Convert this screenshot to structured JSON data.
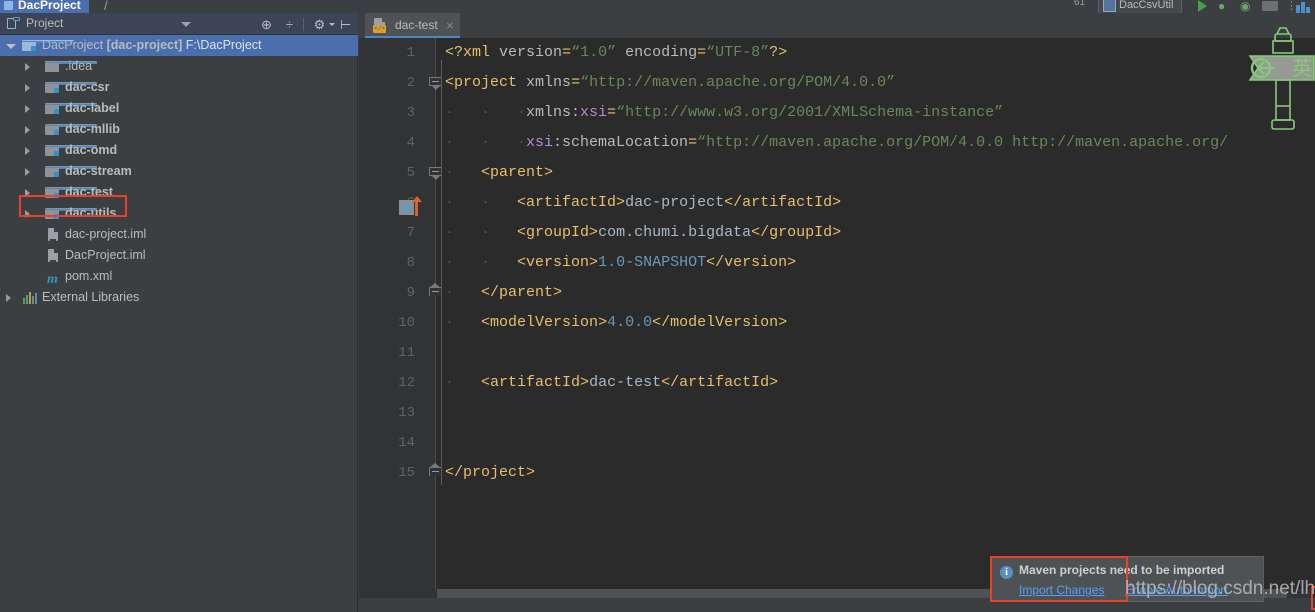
{
  "window": {
    "breadcrumb": "DacProject",
    "breadcrumb_sep": "/"
  },
  "topbar": {
    "run_config": "DacCsvUtil",
    "line_indicator": "61",
    "icons": [
      "run-icon",
      "debug-icon",
      "coverage-icon",
      "stop-icon",
      "more-icon",
      "layout-icon"
    ]
  },
  "project_panel": {
    "title": "Project",
    "toolbar": {
      "locate": "target-icon",
      "collapse_all": "collapse-all-icon",
      "settings": "gear-icon",
      "hide": "hide-icon"
    },
    "tree": [
      {
        "label": "DacProject",
        "module": "[dac-project]",
        "path": "F:\\DacProject",
        "icon": "module-folder-icon",
        "depth": 0,
        "state": "expanded",
        "selected": true
      },
      {
        "label": ".idea",
        "icon": "folder-icon",
        "depth": 1,
        "state": "collapsed",
        "selected": false
      },
      {
        "label": "dac-csr",
        "icon": "module-folder-icon",
        "depth": 1,
        "state": "collapsed",
        "selected": false
      },
      {
        "label": "dac-label",
        "icon": "module-folder-icon",
        "depth": 1,
        "state": "collapsed",
        "selected": false
      },
      {
        "label": "dac-mllib",
        "icon": "module-folder-icon",
        "depth": 1,
        "state": "collapsed",
        "selected": false
      },
      {
        "label": "dac-omd",
        "icon": "module-folder-icon",
        "depth": 1,
        "state": "collapsed",
        "selected": false
      },
      {
        "label": "dac-stream",
        "icon": "module-folder-icon",
        "depth": 1,
        "state": "collapsed",
        "selected": false
      },
      {
        "label": "dac-test",
        "icon": "module-folder-icon",
        "depth": 1,
        "state": "collapsed",
        "selected": false,
        "highlighted": true
      },
      {
        "label": "dac-utils",
        "icon": "module-folder-icon",
        "depth": 1,
        "state": "collapsed",
        "selected": false
      },
      {
        "label": "dac-project.iml",
        "icon": "iml-file-icon",
        "depth": 1,
        "state": "leaf",
        "selected": false
      },
      {
        "label": "DacProject.iml",
        "icon": "iml-file-icon",
        "depth": 1,
        "state": "leaf",
        "selected": false
      },
      {
        "label": "pom.xml",
        "icon": "maven-file-icon",
        "depth": 1,
        "state": "leaf",
        "selected": false
      },
      {
        "label": "External Libraries",
        "icon": "libraries-icon",
        "depth": 0,
        "state": "collapsed",
        "selected": false
      }
    ]
  },
  "editor": {
    "tabs": [
      {
        "label": "dac-test",
        "icon": "xml-file-icon",
        "active": true,
        "close": "×"
      }
    ],
    "gutter_icon_line": 5,
    "gutter_icon_name": "maven-reimport-icon",
    "lines": [
      {
        "n": "1",
        "indent": 0,
        "tokens": [
          {
            "t": "punct",
            "v": "<?"
          },
          {
            "t": "tag",
            "v": "xml"
          },
          {
            "t": "text",
            "v": " "
          },
          {
            "t": "attr",
            "v": "version"
          },
          {
            "t": "punct",
            "v": "="
          },
          {
            "t": "str",
            "v": "“1.0”"
          },
          {
            "t": "text",
            "v": " "
          },
          {
            "t": "attr",
            "v": "encoding"
          },
          {
            "t": "punct",
            "v": "="
          },
          {
            "t": "str",
            "v": "“UTF-8”"
          },
          {
            "t": "punct",
            "v": "?>"
          }
        ]
      },
      {
        "n": "2",
        "indent": 0,
        "fold": "start",
        "tokens": [
          {
            "t": "punct",
            "v": "<"
          },
          {
            "t": "tag",
            "v": "project"
          },
          {
            "t": "text",
            "v": " "
          },
          {
            "t": "attr",
            "v": "xmlns"
          },
          {
            "t": "punct",
            "v": "="
          },
          {
            "t": "str",
            "v": "“http://maven.apache.org/POM/4.0.0”"
          }
        ]
      },
      {
        "n": "3",
        "indent": 9,
        "tokens": [
          {
            "t": "attr",
            "v": "xmlns:"
          },
          {
            "t": "ns",
            "v": "xsi"
          },
          {
            "t": "punct",
            "v": "="
          },
          {
            "t": "str",
            "v": "“http://www.w3.org/2001/XMLSchema-instance”"
          }
        ]
      },
      {
        "n": "4",
        "indent": 9,
        "tokens": [
          {
            "t": "ns",
            "v": "xsi"
          },
          {
            "t": "attr",
            "v": ":schemaLocation"
          },
          {
            "t": "punct",
            "v": "="
          },
          {
            "t": "str",
            "v": "“http://maven.apache.org/POM/4.0.0 http://maven.apache.org/"
          }
        ]
      },
      {
        "n": "5",
        "indent": 4,
        "fold": "start",
        "tokens": [
          {
            "t": "punct",
            "v": "<"
          },
          {
            "t": "tag",
            "v": "parent"
          },
          {
            "t": "punct",
            "v": ">"
          }
        ]
      },
      {
        "n": "6",
        "indent": 8,
        "tokens": [
          {
            "t": "punct",
            "v": "<"
          },
          {
            "t": "tag",
            "v": "artifactId"
          },
          {
            "t": "punct",
            "v": ">"
          },
          {
            "t": "text",
            "v": "dac-project"
          },
          {
            "t": "punct",
            "v": "</"
          },
          {
            "t": "tag",
            "v": "artifactId"
          },
          {
            "t": "punct",
            "v": ">"
          }
        ]
      },
      {
        "n": "7",
        "indent": 8,
        "tokens": [
          {
            "t": "punct",
            "v": "<"
          },
          {
            "t": "tag",
            "v": "groupId"
          },
          {
            "t": "punct",
            "v": ">"
          },
          {
            "t": "text",
            "v": "com.chumi.bigdata"
          },
          {
            "t": "punct",
            "v": "</"
          },
          {
            "t": "tag",
            "v": "groupId"
          },
          {
            "t": "punct",
            "v": ">"
          }
        ]
      },
      {
        "n": "8",
        "indent": 8,
        "tokens": [
          {
            "t": "punct",
            "v": "<"
          },
          {
            "t": "tag",
            "v": "version"
          },
          {
            "t": "punct",
            "v": ">"
          },
          {
            "t": "num",
            "v": "1.0-SNAPSHOT"
          },
          {
            "t": "punct",
            "v": "</"
          },
          {
            "t": "tag",
            "v": "version"
          },
          {
            "t": "punct",
            "v": ">"
          }
        ]
      },
      {
        "n": "9",
        "indent": 4,
        "fold": "end",
        "tokens": [
          {
            "t": "punct",
            "v": "</"
          },
          {
            "t": "tag",
            "v": "parent"
          },
          {
            "t": "punct",
            "v": ">"
          }
        ]
      },
      {
        "n": "10",
        "indent": 4,
        "tokens": [
          {
            "t": "punct",
            "v": "<"
          },
          {
            "t": "tag",
            "v": "modelVersion"
          },
          {
            "t": "punct",
            "v": ">"
          },
          {
            "t": "num",
            "v": "4.0.0"
          },
          {
            "t": "punct",
            "v": "</"
          },
          {
            "t": "tag",
            "v": "modelVersion"
          },
          {
            "t": "punct",
            "v": ">"
          }
        ]
      },
      {
        "n": "11",
        "indent": 0,
        "tokens": []
      },
      {
        "n": "12",
        "indent": 4,
        "tokens": [
          {
            "t": "punct",
            "v": "<"
          },
          {
            "t": "tag",
            "v": "artifactId"
          },
          {
            "t": "punct",
            "v": ">"
          },
          {
            "t": "text",
            "v": "dac-test"
          },
          {
            "t": "punct",
            "v": "</"
          },
          {
            "t": "tag",
            "v": "artifactId"
          },
          {
            "t": "punct",
            "v": ">"
          }
        ]
      },
      {
        "n": "13",
        "indent": 0,
        "tokens": []
      },
      {
        "n": "14",
        "indent": 0,
        "tokens": []
      },
      {
        "n": "15",
        "indent": 0,
        "fold": "end",
        "tokens": [
          {
            "t": "punct",
            "v": "</"
          },
          {
            "t": "tag",
            "v": "project"
          },
          {
            "t": "punct",
            "v": ">"
          }
        ]
      }
    ]
  },
  "notification": {
    "icon": "info-icon",
    "icon_glyph": "i",
    "title": "Maven projects need to be imported",
    "action_primary": "Import Changes",
    "action_secondary": "Enable Auto-Import"
  },
  "overlays": {
    "watermark": "https://blog.csdn.net/lhxsir",
    "signpost_label": "英",
    "signpost_name": "ime-signpost-icon"
  },
  "colors": {
    "accent_blue": "#4b6eaf",
    "tab_underline": "#4a88c7",
    "editor_bg": "#2b2b2b",
    "panel_bg": "#3c3f41",
    "gutter_bg": "#313335",
    "highlight_red": "#e8402a",
    "string_green": "#6a8759",
    "tag_orange": "#e8bf6a",
    "number_blue": "#6897bb",
    "link_blue": "#589df6"
  }
}
